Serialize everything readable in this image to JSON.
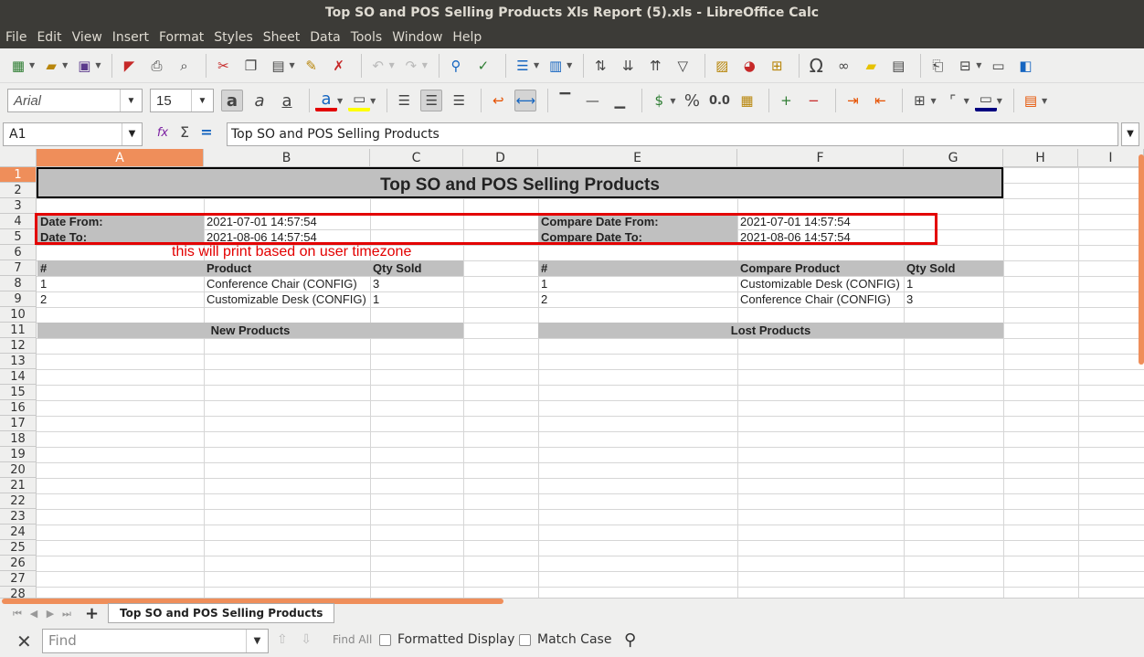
{
  "window": {
    "title": "Top SO and POS Selling Products Xls Report (5).xls - LibreOffice Calc"
  },
  "menu": [
    "File",
    "Edit",
    "View",
    "Insert",
    "Format",
    "Styles",
    "Sheet",
    "Data",
    "Tools",
    "Window",
    "Help"
  ],
  "toolbar2": {
    "font_name": "Arial",
    "font_size": "15",
    "percent": "%",
    "decimal": "0.0"
  },
  "formula_bar": {
    "cell_ref": "A1",
    "content": "Top SO and POS Selling Products",
    "fx": "fx",
    "sum": "Σ",
    "eq": "="
  },
  "columns": [
    "A",
    "B",
    "C",
    "D",
    "E",
    "F",
    "G",
    "H",
    "I"
  ],
  "rows": [
    "1",
    "2",
    "3",
    "4",
    "5",
    "6",
    "7",
    "8",
    "9",
    "10",
    "11",
    "12",
    "13",
    "14",
    "15",
    "16",
    "17",
    "18",
    "19",
    "20",
    "21",
    "22",
    "23",
    "24",
    "25",
    "26",
    "27",
    "28"
  ],
  "sheet": {
    "title": "Top SO and POS Selling Products",
    "date_from_label": "Date From:",
    "date_from_value": "2021-07-01 14:57:54",
    "date_to_label": "Date To:",
    "date_to_value": "2021-08-06 14:57:54",
    "compare_from_label": "Compare Date From:",
    "compare_from_value": "2021-07-01 14:57:54",
    "compare_to_label": "Compare Date To:",
    "compare_to_value": "2021-08-06 14:57:54",
    "note": "this will print based on user timezone",
    "left_headers": [
      "#",
      "Product",
      "Qty Sold"
    ],
    "right_headers": [
      "#",
      "Compare Product",
      "Qty Sold"
    ],
    "left_rows": [
      [
        "1",
        "Conference Chair (CONFIG)",
        "3"
      ],
      [
        "2",
        "Customizable Desk (CONFIG)",
        "1"
      ]
    ],
    "right_rows": [
      [
        "1",
        "Customizable Desk (CONFIG)",
        "1"
      ],
      [
        "2",
        "Conference Chair (CONFIG)",
        "3"
      ]
    ],
    "new_products": "New Products",
    "lost_products": "Lost Products"
  },
  "tabs": {
    "sheet_tab": "Top SO and POS Selling Products",
    "add": "+"
  },
  "findbar": {
    "placeholder": "Find",
    "find_all": "Find All",
    "formatted_display": "Formatted Display",
    "match_case": "Match Case"
  },
  "colors": {
    "accent": "#ef8e5a",
    "highlight": "#e30000",
    "header_grey": "#c0c0c0"
  }
}
